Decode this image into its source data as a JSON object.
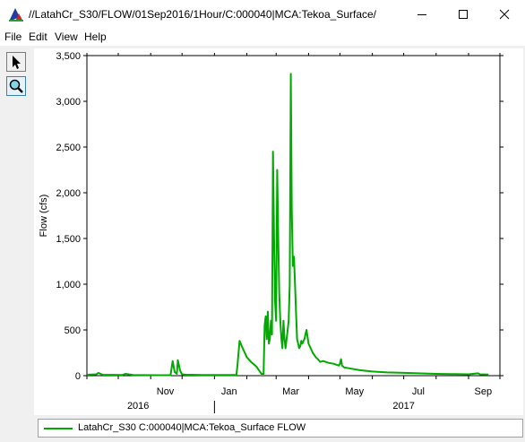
{
  "window": {
    "title": "//LatahCr_S30/FLOW/01Sep2016/1Hour/C:000040|MCA:Tekoa_Surface/",
    "controls": [
      "minimize-icon",
      "maximize-icon",
      "close-icon"
    ]
  },
  "menu": [
    "File",
    "Edit",
    "View",
    "Help"
  ],
  "toolbar": {
    "tools": [
      "pointer-icon",
      "zoom-icon"
    ]
  },
  "chart_data": {
    "type": "line",
    "title": "",
    "xlabel": "",
    "ylabel": "Flow (cfs)",
    "ylim": [
      0,
      3500
    ],
    "yticks": [
      "0",
      "500",
      "1,000",
      "1,500",
      "2,000",
      "2,500",
      "3,000",
      "3,500"
    ],
    "x_month_ticks": [
      "Nov",
      "Jan",
      "Mar",
      "May",
      "Jul",
      "Sep"
    ],
    "x_year_labels": [
      "2016",
      "2017"
    ],
    "grid": false,
    "series": [
      {
        "name": "LatahCr_S30 C:000040|MCA:Tekoa_Surface FLOW",
        "color": "#00aa00",
        "x": [
          "2016-09-01",
          "2016-09-10",
          "2016-09-12",
          "2016-09-16",
          "2016-10-05",
          "2016-10-08",
          "2016-10-15",
          "2016-11-05",
          "2016-11-20",
          "2016-11-22",
          "2016-11-24",
          "2016-11-26",
          "2016-11-27",
          "2016-11-29",
          "2016-12-01",
          "2016-12-05",
          "2016-12-10",
          "2016-12-20",
          "2017-01-05",
          "2017-01-15",
          "2017-01-22",
          "2017-01-23",
          "2017-01-25",
          "2017-01-28",
          "2017-02-01",
          "2017-02-05",
          "2017-02-10",
          "2017-02-15",
          "2017-02-17",
          "2017-02-18",
          "2017-02-19",
          "2017-02-20",
          "2017-02-21",
          "2017-02-22",
          "2017-02-23",
          "2017-02-24",
          "2017-02-25",
          "2017-02-26",
          "2017-02-27",
          "2017-02-28",
          "2017-03-01",
          "2017-03-02",
          "2017-03-03",
          "2017-03-04",
          "2017-03-05",
          "2017-03-06",
          "2017-03-07",
          "2017-03-08",
          "2017-03-09",
          "2017-03-10",
          "2017-03-11",
          "2017-03-12",
          "2017-03-13",
          "2017-03-14",
          "2017-03-15",
          "2017-03-16",
          "2017-03-17",
          "2017-03-18",
          "2017-03-19",
          "2017-03-20",
          "2017-03-21",
          "2017-03-22",
          "2017-03-23",
          "2017-03-24",
          "2017-03-25",
          "2017-03-26",
          "2017-03-28",
          "2017-03-30",
          "2017-04-01",
          "2017-04-03",
          "2017-04-05",
          "2017-04-08",
          "2017-04-10",
          "2017-04-12",
          "2017-04-15",
          "2017-04-20",
          "2017-04-25",
          "2017-04-30",
          "2017-05-01",
          "2017-05-02",
          "2017-05-03",
          "2017-05-05",
          "2017-05-10",
          "2017-05-20",
          "2017-06-01",
          "2017-06-15",
          "2017-07-01",
          "2017-07-15",
          "2017-08-01",
          "2017-08-15",
          "2017-09-01",
          "2017-09-10",
          "2017-09-12",
          "2017-09-20"
        ],
        "values": [
          10,
          15,
          30,
          10,
          8,
          20,
          8,
          5,
          5,
          160,
          40,
          20,
          170,
          60,
          15,
          10,
          10,
          8,
          8,
          8,
          8,
          120,
          380,
          300,
          200,
          150,
          100,
          20,
          20,
          550,
          650,
          400,
          700,
          350,
          400,
          600,
          450,
          2450,
          1500,
          800,
          600,
          2250,
          1500,
          900,
          600,
          400,
          300,
          600,
          400,
          300,
          400,
          500,
          600,
          1000,
          3300,
          1800,
          1200,
          1300,
          1000,
          700,
          400,
          350,
          300,
          320,
          380,
          350,
          400,
          500,
          350,
          300,
          250,
          200,
          180,
          150,
          160,
          140,
          130,
          110,
          130,
          180,
          110,
          90,
          80,
          60,
          45,
          35,
          30,
          25,
          20,
          18,
          15,
          25,
          15,
          12
        ]
      }
    ]
  },
  "legend": {
    "text": "LatahCr_S30 C:000040|MCA:Tekoa_Surface FLOW"
  }
}
